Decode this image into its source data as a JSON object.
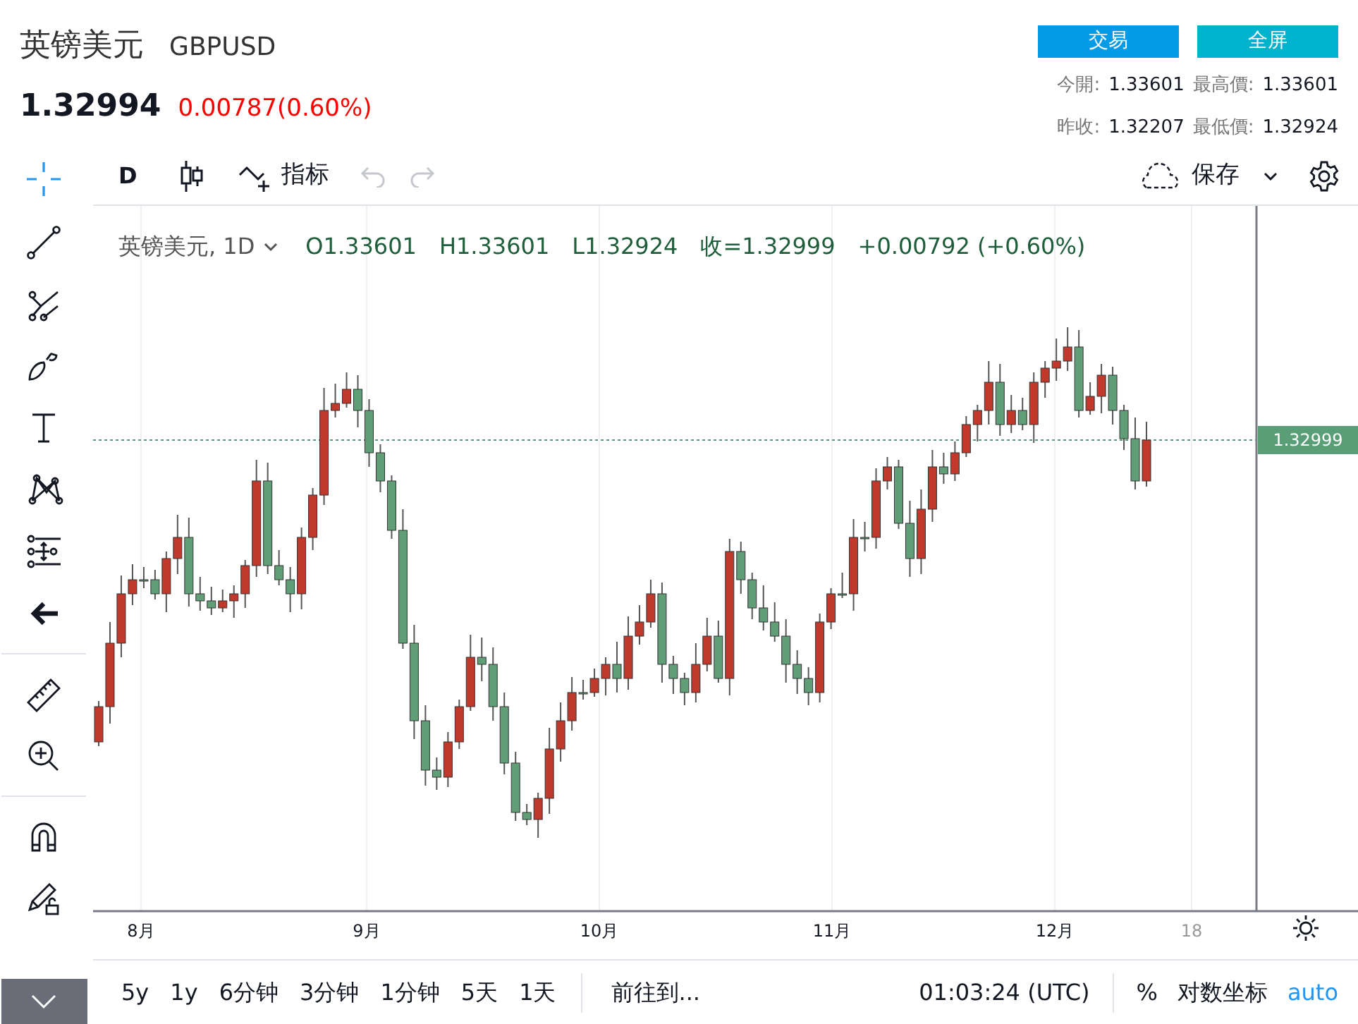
{
  "header": {
    "name": "英镑美元",
    "symbol": "GBPUSD",
    "price": "1.32994",
    "change": "0.00787(0.60%)"
  },
  "actions": [
    {
      "label": "交易",
      "kind": "trade"
    },
    {
      "label": "全屏",
      "kind": "fullscreen"
    }
  ],
  "stats": [
    {
      "label": "今開:",
      "value": "1.33601"
    },
    {
      "label": "最高價:",
      "value": "1.33601"
    },
    {
      "label": "昨收:",
      "value": "1.32207"
    },
    {
      "label": "最低價:",
      "value": "1.32924"
    }
  ],
  "toolbar": {
    "interval": "D",
    "indicators": "指标",
    "save": "保存"
  },
  "legend": {
    "title": "英镑美元, 1D",
    "open": "O1.33601",
    "high": "H1.33601",
    "low": "L1.32924",
    "close": "收=1.32999",
    "change": "+0.00792 (+0.60%)"
  },
  "price_label": "1.32999",
  "time_axis": [
    "8月",
    "9月",
    "10月",
    "11月",
    "12月",
    "18"
  ],
  "ranges": [
    "5y",
    "1y",
    "6分钟",
    "3分钟",
    "1分钟",
    "5天",
    "1天"
  ],
  "goto": "前往到...",
  "clock": "01:03:24 (UTC)",
  "scale_options": [
    {
      "label": "%",
      "active": false
    },
    {
      "label": "对数坐标",
      "active": false
    },
    {
      "label": "auto",
      "active": true
    }
  ]
}
